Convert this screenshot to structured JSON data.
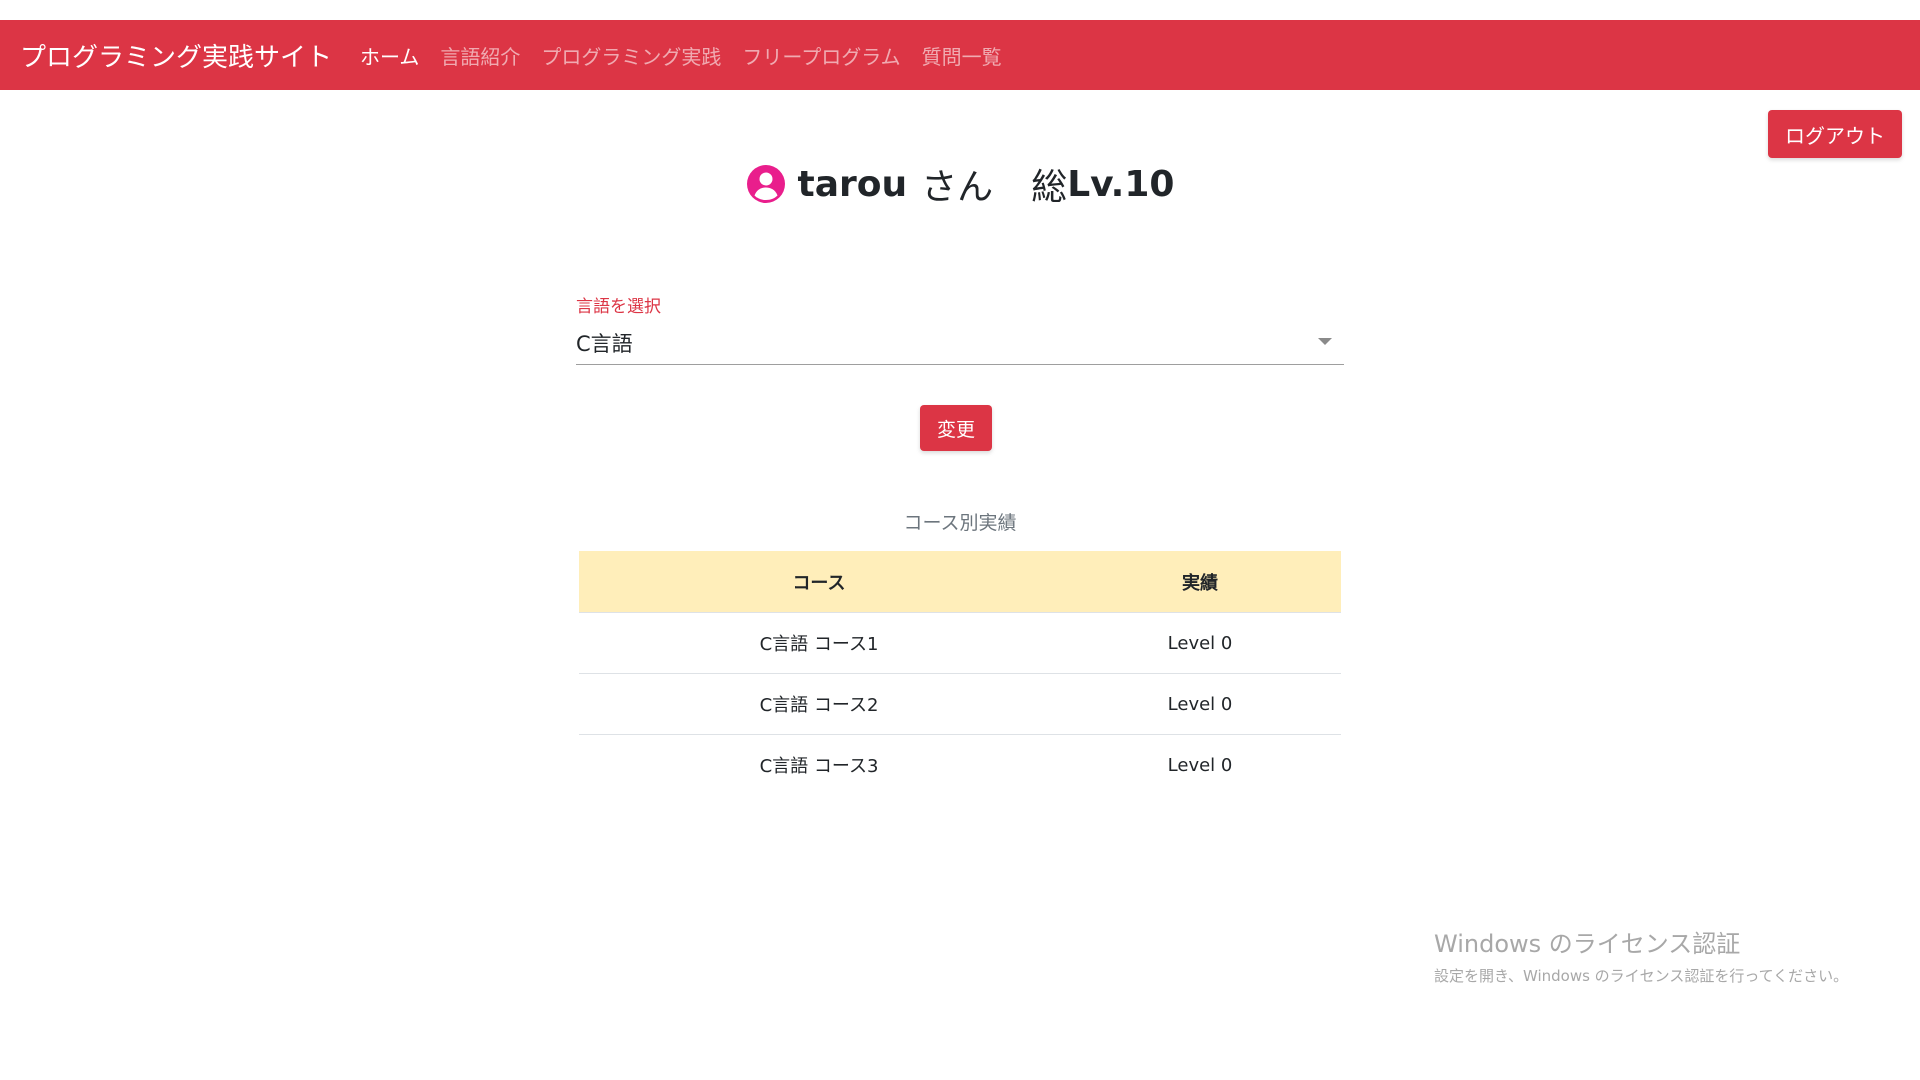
{
  "navbar": {
    "brand": "プログラミング実践サイト",
    "links": [
      {
        "label": "ホーム",
        "active": true
      },
      {
        "label": "言語紹介",
        "active": false
      },
      {
        "label": "プログラミング実践",
        "active": false
      },
      {
        "label": "フリープログラム",
        "active": false
      },
      {
        "label": "質問一覧",
        "active": false
      }
    ],
    "color": "#dc3545"
  },
  "logout_label": "ログアウト",
  "profile": {
    "icon": "user-circle-icon",
    "icon_color": "#e91e8c",
    "username": "tarou",
    "suffix": "さん",
    "level_prefix": "総",
    "level": "Lv.10"
  },
  "language_select": {
    "label": "言語を選択",
    "value": "C言語"
  },
  "change_label": "変更",
  "results": {
    "caption": "コース別実績",
    "headers": [
      "コース",
      "実績"
    ],
    "rows": [
      [
        "C言語 コース1",
        "Level 0"
      ],
      [
        "C言語 コース2",
        "Level 0"
      ],
      [
        "C言語 コース3",
        "Level 0"
      ]
    ],
    "header_color": "#ffeeba"
  },
  "watermark": {
    "title": "Windows のライセンス認証",
    "subtitle": "設定を開き、Windows のライセンス認証を行ってください。"
  }
}
